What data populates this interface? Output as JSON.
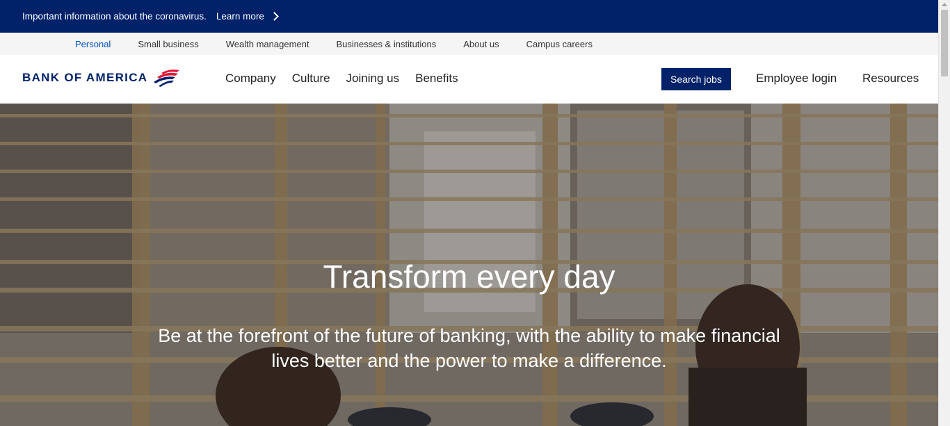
{
  "alert": {
    "message": "Important information about the coronavirus.",
    "link_label": "Learn more"
  },
  "segments": [
    {
      "label": "Personal",
      "active": true
    },
    {
      "label": "Small business",
      "active": false
    },
    {
      "label": "Wealth management",
      "active": false
    },
    {
      "label": "Businesses & institutions",
      "active": false
    },
    {
      "label": "About us",
      "active": false
    },
    {
      "label": "Campus careers",
      "active": false
    }
  ],
  "header": {
    "logo_text": "BANK OF AMERICA",
    "nav": [
      "Company",
      "Culture",
      "Joining us",
      "Benefits"
    ],
    "search_label": "Search jobs",
    "employee_login": "Employee login",
    "resources": "Resources"
  },
  "hero": {
    "title": "Transform every day",
    "subtitle": "Be at the forefront of the future of banking, with the ability to make financial lives better and the power to make a difference."
  },
  "colors": {
    "brand_navy": "#012169",
    "brand_red": "#e31837",
    "active_link": "#0052c2"
  }
}
